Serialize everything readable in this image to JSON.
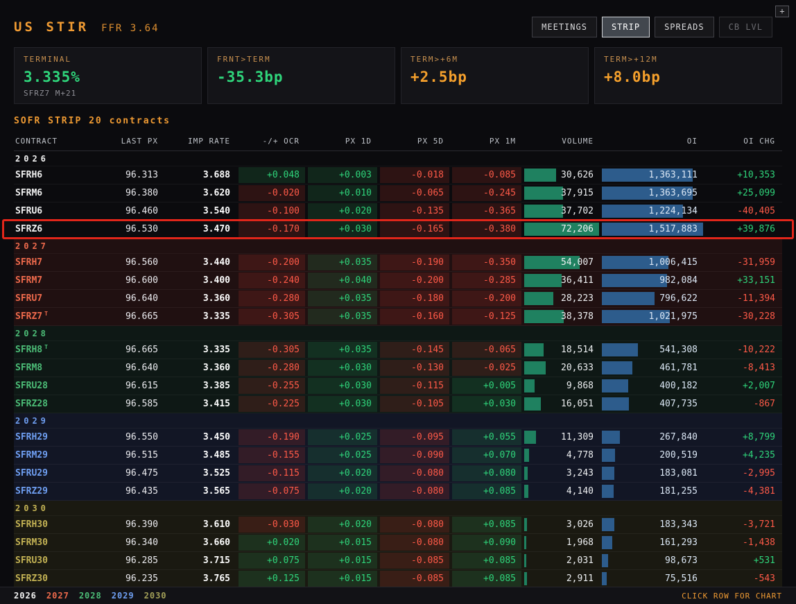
{
  "header": {
    "title": "US STIR",
    "ffr": "FFR 3.64",
    "plus": "+",
    "tabs": [
      {
        "label": "MEETINGS",
        "state": "normal"
      },
      {
        "label": "STRIP",
        "state": "active"
      },
      {
        "label": "SPREADS",
        "state": "normal"
      },
      {
        "label": "CB LVL",
        "state": "dim"
      }
    ]
  },
  "cards": [
    {
      "label": "TERMINAL",
      "value": "3.335%",
      "value_color": "green",
      "sub": "SFRZ7 M+21"
    },
    {
      "label": "FRNT>TERM",
      "value": "-35.3bp",
      "value_color": "green",
      "sub": ""
    },
    {
      "label": "TERM>+6M",
      "value": "+2.5bp",
      "value_color": "orange",
      "sub": ""
    },
    {
      "label": "TERM>+12M",
      "value": "+8.0bp",
      "value_color": "orange",
      "sub": ""
    }
  ],
  "strip": {
    "title": "SOFR STRIP 20 contracts"
  },
  "highlight_contract": "SFRZ6",
  "table": {
    "columns": [
      "CONTRACT",
      "LAST PX",
      "IMP RATE",
      "-/+ OCR",
      "PX 1D",
      "PX 5D",
      "PX 1M",
      "VOLUME",
      "OI",
      "OI CHG"
    ],
    "max_volume": 72206,
    "max_oi": 1517883,
    "groups": [
      {
        "year": "2026",
        "color": "#f2f2f2",
        "tint": "transparent",
        "rows": [
          {
            "contract": "SFRH6",
            "marker": "",
            "last_px": "96.313",
            "imp_rate": "3.688",
            "ocr": "+0.048",
            "px_1d": "+0.003",
            "px_5d": "-0.018",
            "px_1m": "-0.085",
            "volume": "30,626",
            "oi": "1,363,111",
            "oi_chg": "+10,353"
          },
          {
            "contract": "SFRM6",
            "marker": "",
            "last_px": "96.380",
            "imp_rate": "3.620",
            "ocr": "-0.020",
            "px_1d": "+0.010",
            "px_5d": "-0.065",
            "px_1m": "-0.245",
            "volume": "37,915",
            "oi": "1,363,695",
            "oi_chg": "+25,099"
          },
          {
            "contract": "SFRU6",
            "marker": "",
            "last_px": "96.460",
            "imp_rate": "3.540",
            "ocr": "-0.100",
            "px_1d": "+0.020",
            "px_5d": "-0.135",
            "px_1m": "-0.365",
            "volume": "37,702",
            "oi": "1,224,134",
            "oi_chg": "-40,405"
          },
          {
            "contract": "SFRZ6",
            "marker": "",
            "last_px": "96.530",
            "imp_rate": "3.470",
            "ocr": "-0.170",
            "px_1d": "+0.030",
            "px_5d": "-0.165",
            "px_1m": "-0.380",
            "volume": "72,206",
            "oi": "1,517,883",
            "oi_chg": "+39,876"
          }
        ]
      },
      {
        "year": "2027",
        "color": "#ef6a4c",
        "tint": "rgba(225,70,50,0.10)",
        "rows": [
          {
            "contract": "SFRH7",
            "marker": "",
            "last_px": "96.560",
            "imp_rate": "3.440",
            "ocr": "-0.200",
            "px_1d": "+0.035",
            "px_5d": "-0.190",
            "px_1m": "-0.350",
            "volume": "54,007",
            "oi": "1,006,415",
            "oi_chg": "-31,959"
          },
          {
            "contract": "SFRM7",
            "marker": "",
            "last_px": "96.600",
            "imp_rate": "3.400",
            "ocr": "-0.240",
            "px_1d": "+0.040",
            "px_5d": "-0.200",
            "px_1m": "-0.285",
            "volume": "36,411",
            "oi": "982,084",
            "oi_chg": "+33,151"
          },
          {
            "contract": "SFRU7",
            "marker": "",
            "last_px": "96.640",
            "imp_rate": "3.360",
            "ocr": "-0.280",
            "px_1d": "+0.035",
            "px_5d": "-0.180",
            "px_1m": "-0.200",
            "volume": "28,223",
            "oi": "796,622",
            "oi_chg": "-11,394"
          },
          {
            "contract": "SFRZ7",
            "marker": "T",
            "last_px": "96.665",
            "imp_rate": "3.335",
            "ocr": "-0.305",
            "px_1d": "+0.035",
            "px_5d": "-0.160",
            "px_1m": "-0.125",
            "volume": "38,378",
            "oi": "1,021,975",
            "oi_chg": "-30,228"
          }
        ]
      },
      {
        "year": "2028",
        "color": "#4cbd77",
        "tint": "rgba(60,200,120,0.07)",
        "rows": [
          {
            "contract": "SFRH8",
            "marker": "T",
            "last_px": "96.665",
            "imp_rate": "3.335",
            "ocr": "-0.305",
            "px_1d": "+0.035",
            "px_5d": "-0.145",
            "px_1m": "-0.065",
            "volume": "18,514",
            "oi": "541,308",
            "oi_chg": "-10,222"
          },
          {
            "contract": "SFRM8",
            "marker": "",
            "last_px": "96.640",
            "imp_rate": "3.360",
            "ocr": "-0.280",
            "px_1d": "+0.030",
            "px_5d": "-0.130",
            "px_1m": "-0.025",
            "volume": "20,633",
            "oi": "461,781",
            "oi_chg": "-8,413"
          },
          {
            "contract": "SFRU28",
            "marker": "",
            "last_px": "96.615",
            "imp_rate": "3.385",
            "ocr": "-0.255",
            "px_1d": "+0.030",
            "px_5d": "-0.115",
            "px_1m": "+0.005",
            "volume": "9,868",
            "oi": "400,182",
            "oi_chg": "+2,007"
          },
          {
            "contract": "SFRZ28",
            "marker": "",
            "last_px": "96.585",
            "imp_rate": "3.415",
            "ocr": "-0.225",
            "px_1d": "+0.030",
            "px_5d": "-0.105",
            "px_1m": "+0.030",
            "volume": "16,051",
            "oi": "407,735",
            "oi_chg": "-867"
          }
        ]
      },
      {
        "year": "2029",
        "color": "#6f9ff2",
        "tint": "rgba(90,130,245,0.10)",
        "rows": [
          {
            "contract": "SFRH29",
            "marker": "",
            "last_px": "96.550",
            "imp_rate": "3.450",
            "ocr": "-0.190",
            "px_1d": "+0.025",
            "px_5d": "-0.095",
            "px_1m": "+0.055",
            "volume": "11,309",
            "oi": "267,840",
            "oi_chg": "+8,799"
          },
          {
            "contract": "SFRM29",
            "marker": "",
            "last_px": "96.515",
            "imp_rate": "3.485",
            "ocr": "-0.155",
            "px_1d": "+0.025",
            "px_5d": "-0.090",
            "px_1m": "+0.070",
            "volume": "4,778",
            "oi": "200,519",
            "oi_chg": "+4,235"
          },
          {
            "contract": "SFRU29",
            "marker": "",
            "last_px": "96.475",
            "imp_rate": "3.525",
            "ocr": "-0.115",
            "px_1d": "+0.020",
            "px_5d": "-0.080",
            "px_1m": "+0.080",
            "volume": "3,243",
            "oi": "183,081",
            "oi_chg": "-2,995"
          },
          {
            "contract": "SFRZ29",
            "marker": "",
            "last_px": "96.435",
            "imp_rate": "3.565",
            "ocr": "-0.075",
            "px_1d": "+0.020",
            "px_5d": "-0.080",
            "px_1m": "+0.085",
            "volume": "4,140",
            "oi": "181,255",
            "oi_chg": "-4,381"
          }
        ]
      },
      {
        "year": "2030",
        "color": "#c3b254",
        "tint": "rgba(205,185,70,0.08)",
        "rows": [
          {
            "contract": "SFRH30",
            "marker": "",
            "last_px": "96.390",
            "imp_rate": "3.610",
            "ocr": "-0.030",
            "px_1d": "+0.020",
            "px_5d": "-0.080",
            "px_1m": "+0.085",
            "volume": "3,026",
            "oi": "183,343",
            "oi_chg": "-3,721"
          },
          {
            "contract": "SFRM30",
            "marker": "",
            "last_px": "96.340",
            "imp_rate": "3.660",
            "ocr": "+0.020",
            "px_1d": "+0.015",
            "px_5d": "-0.080",
            "px_1m": "+0.090",
            "volume": "1,968",
            "oi": "161,293",
            "oi_chg": "-1,438"
          },
          {
            "contract": "SFRU30",
            "marker": "",
            "last_px": "96.285",
            "imp_rate": "3.715",
            "ocr": "+0.075",
            "px_1d": "+0.015",
            "px_5d": "-0.085",
            "px_1m": "+0.085",
            "volume": "2,031",
            "oi": "98,673",
            "oi_chg": "+531"
          },
          {
            "contract": "SFRZ30",
            "marker": "",
            "last_px": "96.235",
            "imp_rate": "3.765",
            "ocr": "+0.125",
            "px_1d": "+0.015",
            "px_5d": "-0.085",
            "px_1m": "+0.085",
            "volume": "2,911",
            "oi": "75,516",
            "oi_chg": "-543"
          }
        ]
      }
    ]
  },
  "footer": {
    "years": [
      {
        "label": "2026",
        "color": "#f2f2f2"
      },
      {
        "label": "2027",
        "color": "#ef6a4c"
      },
      {
        "label": "2028",
        "color": "#4cbd77"
      },
      {
        "label": "2029",
        "color": "#6f9ff2"
      },
      {
        "label": "2030",
        "color": "#a3a058"
      }
    ],
    "hint": "CLICK ROW FOR CHART"
  },
  "colors": {
    "accent": "#f09b33",
    "green": "#2fd57b",
    "red": "#ff5a48",
    "orange": "#f5a02c",
    "tan": "#c9914f",
    "volbar": "#1f8160",
    "oibar": "#2d5c8c",
    "highlight": "#e1261a"
  }
}
